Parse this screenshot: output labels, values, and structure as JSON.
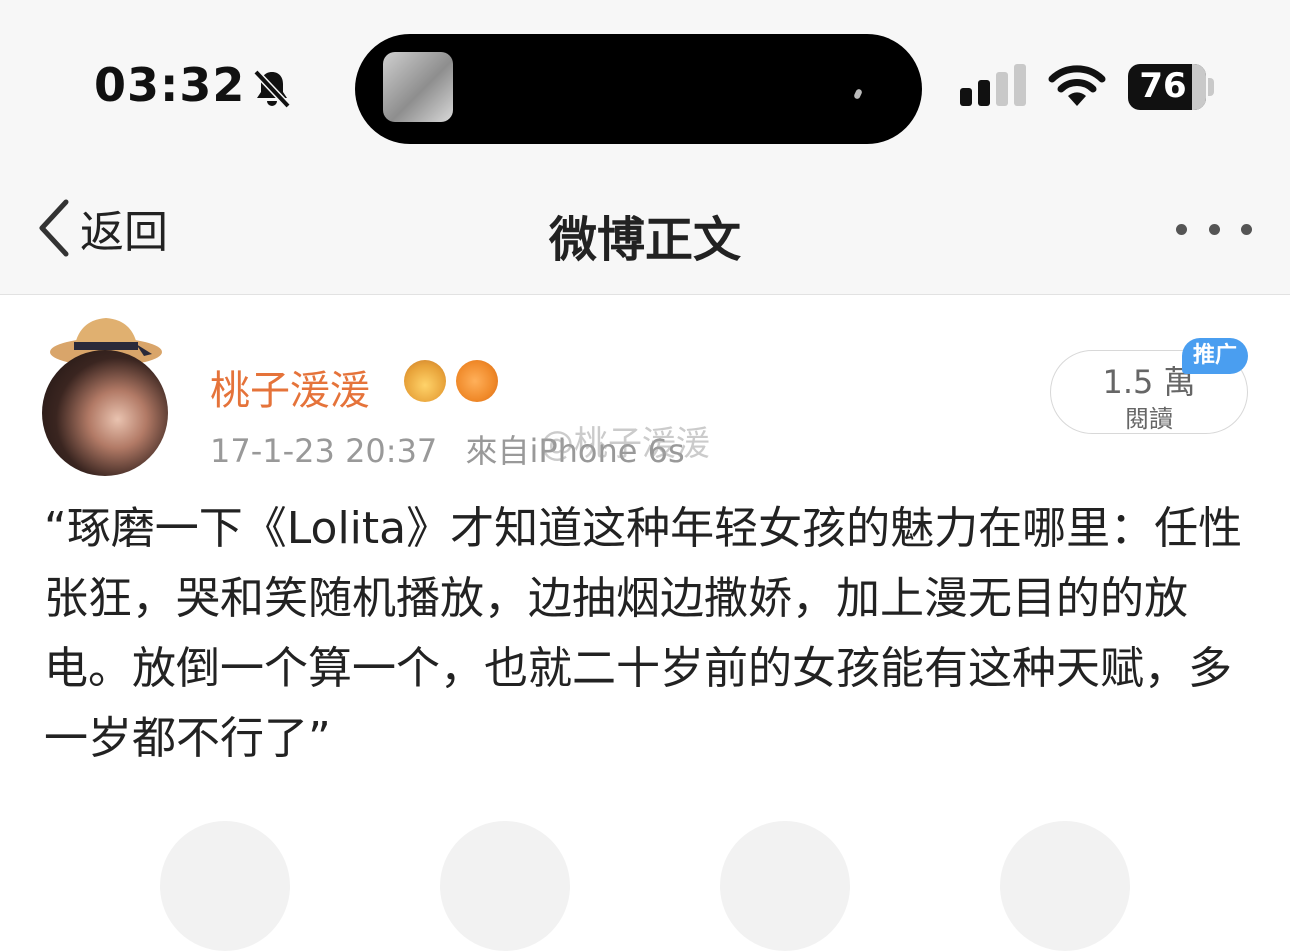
{
  "status_bar": {
    "time": "03:32",
    "battery": "76",
    "icons": [
      "bell-muted-icon",
      "signal-icon",
      "wifi-icon",
      "battery-icon"
    ]
  },
  "nav": {
    "back_label": "返回",
    "title": "微博正文",
    "icons": [
      "chevron-left-icon",
      "more-icon"
    ]
  },
  "post": {
    "author": "桃子湲湲",
    "date": "17-1-23 20:37",
    "source": "來自iPhone 6s",
    "watermark": "@桃子湲湲",
    "reads_count": "1.5 萬",
    "reads_label": "閱讀",
    "promo_tag": "推广",
    "text": "“琢磨一下《Lolita》才知道这种年轻女孩的魅力在哪里：任性张狂，哭和笑随机播放，边抽烟边撒娇，加上漫无目的的放电。放倒一个算一个，也就二十岁前的女孩能有这种天赋，多一岁都不行了”",
    "badges": [
      "crown-badge-icon",
      "fish-badge-icon"
    ]
  },
  "colors": {
    "username": "#e5733a",
    "promo": "#4a9ef0",
    "background_bar": "#f7f7f7"
  }
}
